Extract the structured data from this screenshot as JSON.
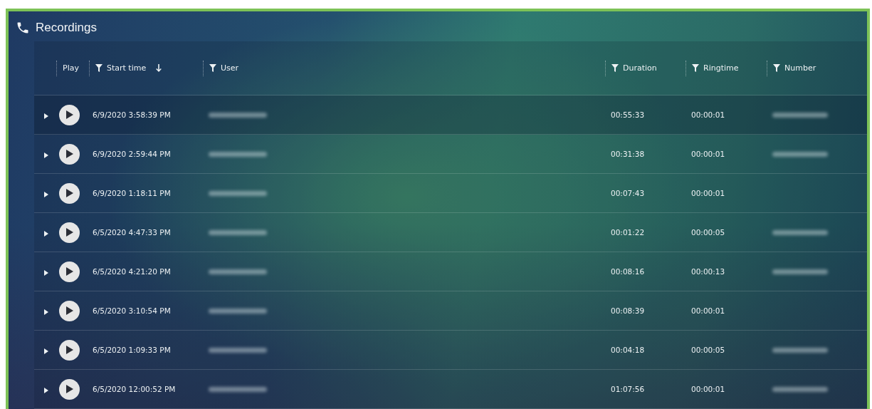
{
  "panel": {
    "title": "Recordings"
  },
  "table": {
    "columns": [
      {
        "label": "Play",
        "filter": false,
        "sorted_descending": false
      },
      {
        "label": "Start time",
        "filter": true,
        "sorted_descending": true
      },
      {
        "label": "User",
        "filter": true,
        "sorted_descending": false
      },
      {
        "label": "Duration",
        "filter": true,
        "sorted_descending": false
      },
      {
        "label": "Ringtime",
        "filter": true,
        "sorted_descending": false
      },
      {
        "label": "Number",
        "filter": true,
        "sorted_descending": false
      }
    ],
    "rows": [
      {
        "selected": true,
        "start_time": "6/9/2020 3:58:39 PM",
        "user_blurred": true,
        "duration": "00:55:33",
        "ringtime": "00:00:01",
        "number_blurred": true
      },
      {
        "selected": false,
        "start_time": "6/9/2020 2:59:44 PM",
        "user_blurred": true,
        "duration": "00:31:38",
        "ringtime": "00:00:01",
        "number_blurred": true
      },
      {
        "selected": false,
        "start_time": "6/9/2020 1:18:11 PM",
        "user_blurred": true,
        "duration": "00:07:43",
        "ringtime": "00:00:01",
        "number_blurred": false
      },
      {
        "selected": false,
        "start_time": "6/5/2020 4:47:33 PM",
        "user_blurred": true,
        "duration": "00:01:22",
        "ringtime": "00:00:05",
        "number_blurred": true
      },
      {
        "selected": false,
        "start_time": "6/5/2020 4:21:20 PM",
        "user_blurred": true,
        "duration": "00:08:16",
        "ringtime": "00:00:13",
        "number_blurred": true
      },
      {
        "selected": false,
        "start_time": "6/5/2020 3:10:54 PM",
        "user_blurred": true,
        "duration": "00:08:39",
        "ringtime": "00:00:01",
        "number_blurred": false
      },
      {
        "selected": false,
        "start_time": "6/5/2020 1:09:33 PM",
        "user_blurred": true,
        "duration": "00:04:18",
        "ringtime": "00:00:05",
        "number_blurred": true
      },
      {
        "selected": false,
        "start_time": "6/5/2020 12:00:52 PM",
        "user_blurred": true,
        "duration": "01:07:56",
        "ringtime": "00:00:01",
        "number_blurred": true
      }
    ]
  }
}
